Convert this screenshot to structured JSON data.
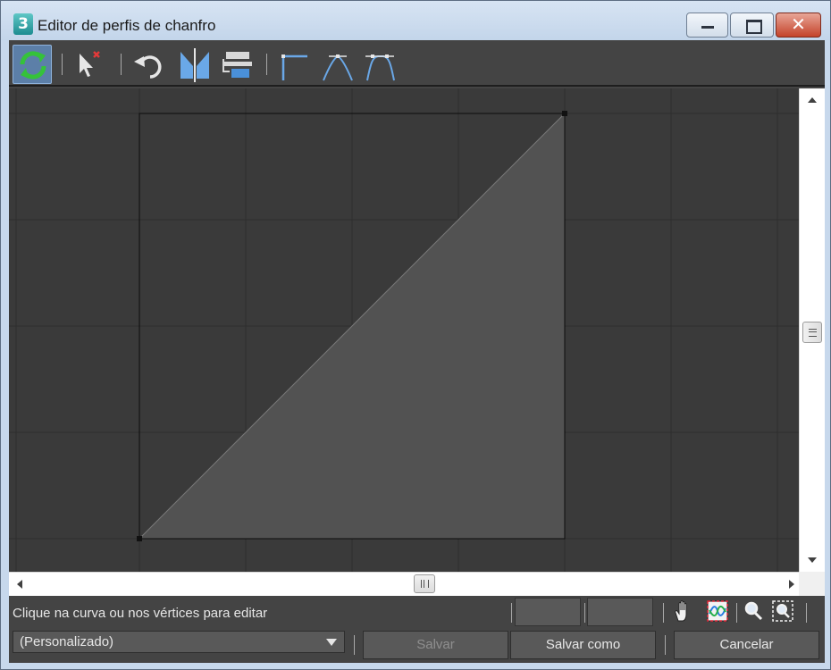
{
  "window": {
    "title": "Editor de perfis de chanfro",
    "app_icon": "3ds-max-icon",
    "app_icon_text": "3",
    "controls": {
      "minimize": "minimize-icon",
      "maximize": "maximize-icon",
      "close": "close-icon",
      "close_glyph": "✕"
    }
  },
  "toolbar": {
    "buttons": [
      {
        "icon": "refresh-icon",
        "active": true
      },
      {
        "icon": "delete-vertex-icon"
      },
      {
        "icon": "undo-icon"
      },
      {
        "icon": "mirror-icon"
      },
      {
        "icon": "insert-profile-icon"
      },
      {
        "icon": "corner-profile-icon"
      },
      {
        "icon": "bezier-corner-icon"
      },
      {
        "icon": "bezier-smooth-icon"
      }
    ]
  },
  "status": {
    "message": "Clique na curva ou nos vértices para editar",
    "x_value": "",
    "y_value": "",
    "nav_icons": [
      "pan-hand-icon",
      "zoom-extents-icon",
      "zoom-icon",
      "zoom-region-icon"
    ]
  },
  "bottom": {
    "preset_selected": "(Personalizado)",
    "save_label": "Salvar",
    "save_as_label": "Salvar como",
    "cancel_label": "Cancelar"
  },
  "colors": {
    "viewport_bg": "#3a3a3a",
    "profile_fill": "#525252",
    "grid_line": "#2e2e2e",
    "frame_line": "#0c0c0c",
    "accent": "#5c7fa8"
  }
}
